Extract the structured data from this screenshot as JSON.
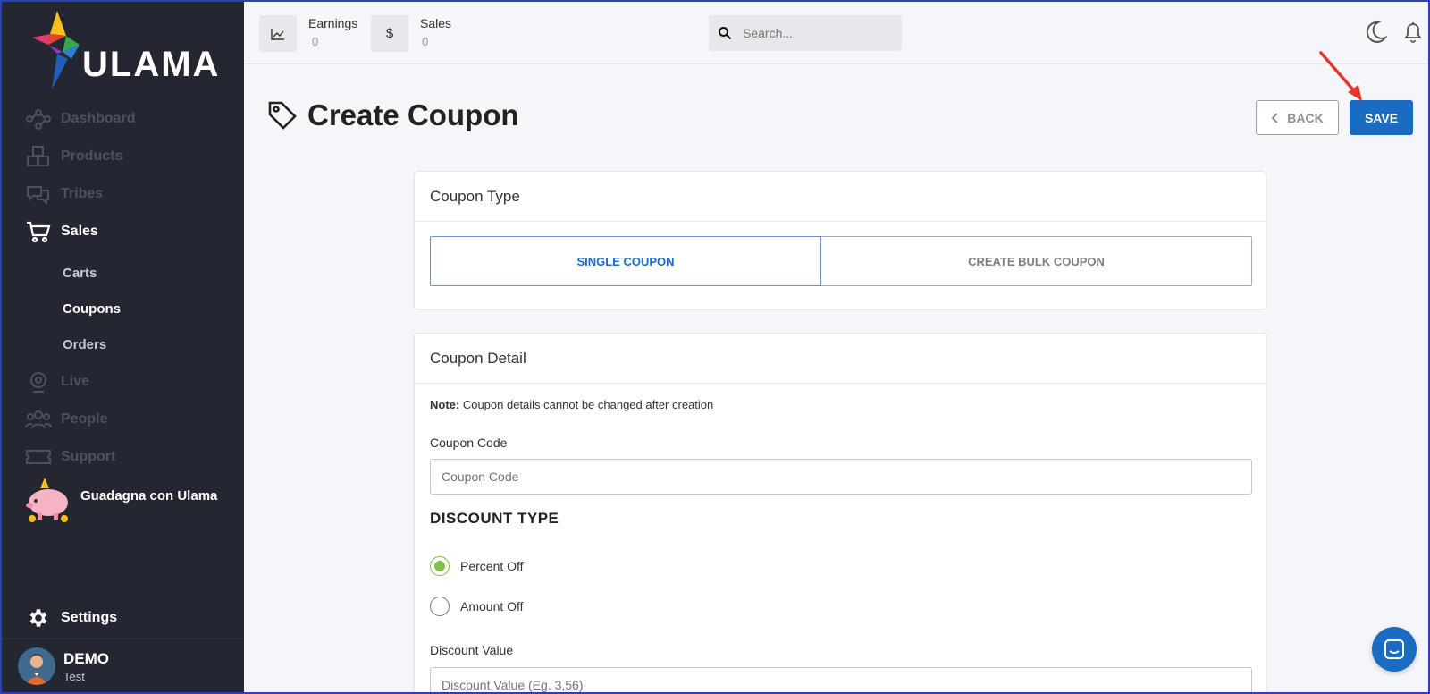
{
  "brand": {
    "name": "ULAMA"
  },
  "sidebar": {
    "items": [
      {
        "label": "Dashboard",
        "icon": "graph-nodes-icon"
      },
      {
        "label": "Products",
        "icon": "boxes-icon"
      },
      {
        "label": "Tribes",
        "icon": "chat-bubbles-icon"
      },
      {
        "label": "Sales",
        "icon": "cart-icon"
      },
      {
        "label": "Live",
        "icon": "webcam-icon"
      },
      {
        "label": "People",
        "icon": "people-icon"
      },
      {
        "label": "Support",
        "icon": "ticket-icon"
      }
    ],
    "sales_sub": [
      "Carts",
      "Coupons",
      "Orders"
    ],
    "promo_label": "Guadagna con Ulama",
    "settings_label": "Settings",
    "user": {
      "name": "DEMO",
      "subtitle": "Test"
    }
  },
  "topbar": {
    "earnings_label": "Earnings",
    "earnings_value": "0",
    "sales_label": "Sales",
    "sales_value": "0",
    "search_placeholder": "Search..."
  },
  "page": {
    "title": "Create Coupon",
    "back_label": "BACK",
    "save_label": "SAVE"
  },
  "coupon_type": {
    "header": "Coupon Type",
    "options": [
      "SINGLE COUPON",
      "CREATE BULK COUPON"
    ],
    "selected": "SINGLE COUPON"
  },
  "coupon_detail": {
    "header": "Coupon Detail",
    "note_label": "Note:",
    "note_text": " Coupon details cannot be changed after creation",
    "code_label": "Coupon Code",
    "code_placeholder": "Coupon Code",
    "discount_type_title": "DISCOUNT TYPE",
    "discount_options": [
      "Percent Off",
      "Amount Off"
    ],
    "discount_selected": "Percent Off",
    "discount_value_label": "Discount Value",
    "discount_value_placeholder": "Discount Value (Eg. 3,56)"
  },
  "colors": {
    "sidebar_bg": "#242732",
    "primary": "#1a6bc2",
    "radio_checked": "#7cc243"
  }
}
